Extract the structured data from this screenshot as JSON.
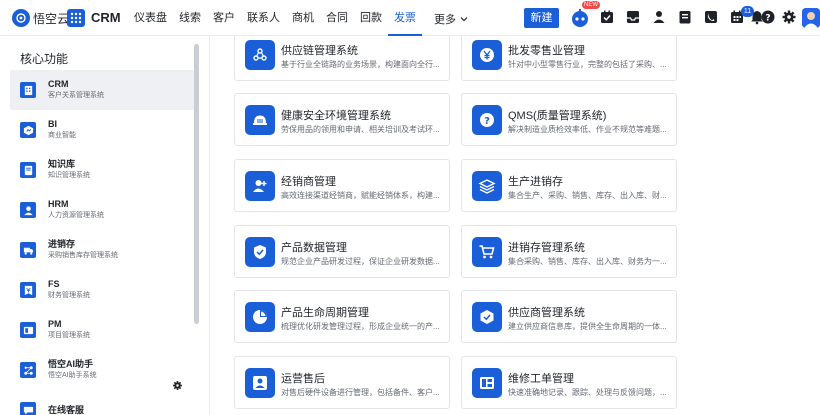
{
  "topbar": {
    "logo_text": "悟空云",
    "product": "CRM",
    "nav": [
      "仪表盘",
      "线索",
      "客户",
      "联系人",
      "商机",
      "合同",
      "回款",
      "发票"
    ],
    "active_nav": "发票",
    "more_label": "更多",
    "new_button": "新建",
    "new_badge": "NEW",
    "notification_count": "11",
    "icons": [
      "robot-icon",
      "task-check-icon",
      "inbox-icon",
      "user-badge-icon",
      "calendar-icon",
      "phone-icon",
      "date-icon",
      "bell-icon",
      "help-icon",
      "gear-icon",
      "user-avatar"
    ]
  },
  "sidebar": {
    "title": "核心功能",
    "items": [
      {
        "name": "CRM",
        "desc": "客户关系管理系统",
        "icon": "building-icon"
      },
      {
        "name": "BI",
        "desc": "商业智能",
        "icon": "chart-cube-icon"
      },
      {
        "name": "知识库",
        "desc": "知识管理系统",
        "icon": "book-icon"
      },
      {
        "name": "HRM",
        "desc": "人力资源管理系统",
        "icon": "person-icon"
      },
      {
        "name": "进销存",
        "desc": "采购销售库存管理系统",
        "icon": "truck-icon"
      },
      {
        "name": "FS",
        "desc": "财务管理系统",
        "icon": "finance-icon"
      },
      {
        "name": "PM",
        "desc": "项目管理系统",
        "icon": "board-icon"
      },
      {
        "name": "悟空AI助手",
        "desc": "悟空AI助手系统",
        "icon": "network-icon"
      },
      {
        "name": "在线客服",
        "desc": "",
        "icon": "chat-icon"
      }
    ]
  },
  "cards": [
    {
      "title": "供应链管理系统",
      "desc": "基于行业全链路的业务场景，构建面向全行...",
      "icon": "recycle-icon"
    },
    {
      "title": "批发零售业管理",
      "desc": "针对中小型零售行业，完整的包括了采购、...",
      "icon": "yen-icon"
    },
    {
      "title": "健康安全环境管理系统",
      "desc": "劳保用品的领用和申请、相关培训及考试环...",
      "icon": "helmet-icon"
    },
    {
      "title": "QMS(质量管理系统)",
      "desc": "解决制造业质检效率低、作业不规范等难题...",
      "icon": "question-icon"
    },
    {
      "title": "经销商管理",
      "desc": "高效连接渠道经销商，赋能经销体系，构建...",
      "icon": "person-add-icon"
    },
    {
      "title": "生产进销存",
      "desc": "集合生产、采购、销售、库存、出入库、财...",
      "icon": "layers-icon"
    },
    {
      "title": "产品数据管理",
      "desc": "规范企业产品研发过程，保证企业研发数据...",
      "icon": "shield-check-icon"
    },
    {
      "title": "进销存管理系统",
      "desc": "集合采购、销售、库存、出入库、财务为一...",
      "icon": "cart-icon"
    },
    {
      "title": "产品生命周期管理",
      "desc": "梳理优化研发管理过程，形成企业统一的产...",
      "icon": "pie-icon"
    },
    {
      "title": "供应商管理系统",
      "desc": "建立供应商信息库，提供全生命周期的一体...",
      "icon": "cube-check-icon"
    },
    {
      "title": "运营售后",
      "desc": "对售后硬件设备进行管理，包括备件、客户...",
      "icon": "user-service-icon"
    },
    {
      "title": "维修工单管理",
      "desc": "快速准确地记录、跟踪、处理与反馈问题，...",
      "icon": "layout-icon"
    }
  ],
  "colors": {
    "accent": "#1a5fd8",
    "badge_red": "#f54a45"
  }
}
